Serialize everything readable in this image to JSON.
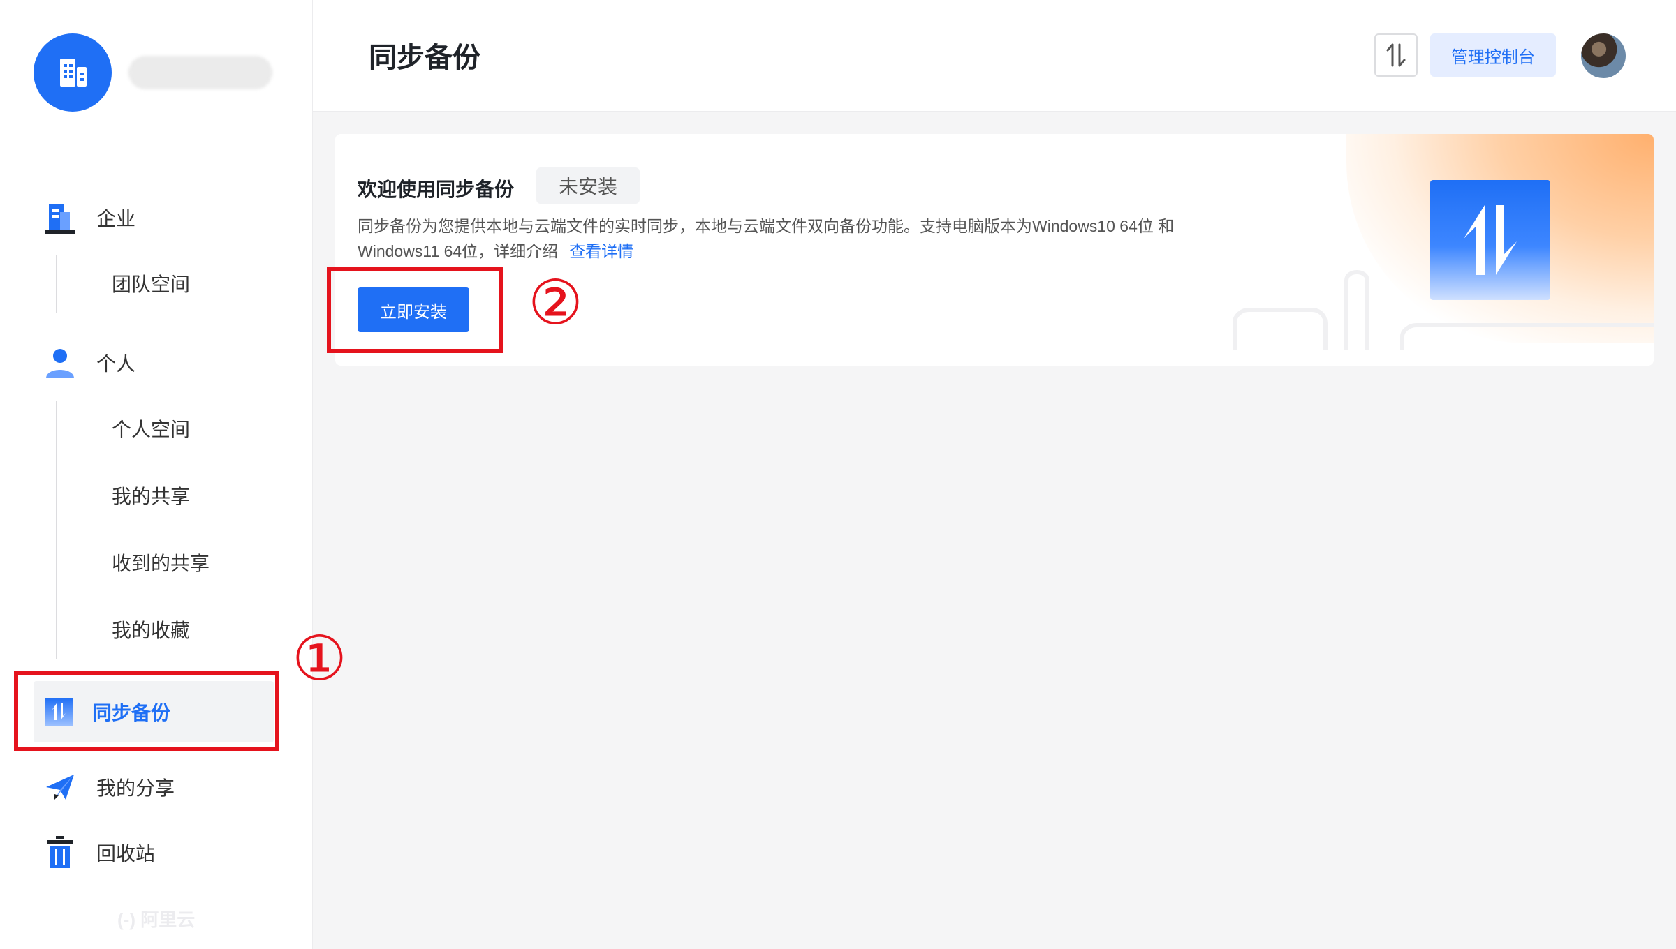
{
  "sidebar": {
    "sections": [
      {
        "label": "企业",
        "icon": "building-icon",
        "children": [
          "团队空间"
        ]
      },
      {
        "label": "个人",
        "icon": "user-icon",
        "children": [
          "个人空间",
          "我的共享",
          "收到的共享",
          "我的收藏"
        ]
      }
    ],
    "active_item": {
      "label": "同步备份",
      "icon": "sync-backup-icon"
    },
    "share_item": {
      "label": "我的分享",
      "icon": "paper-plane-icon"
    },
    "trash_item": {
      "label": "回收站",
      "icon": "trash-icon"
    },
    "footer_logo": "(-) 阿里云"
  },
  "header": {
    "title": "同步备份",
    "transfer_icon": "transfer-icon",
    "admin_button": "管理控制台"
  },
  "card": {
    "title": "欢迎使用同步备份",
    "status_tag": "未安装",
    "description": "同步备份为您提供本地与云端文件的实时同步，本地与云端文件双向备份功能。支持电脑版本为Windows10 64位 和 Windows11 64位，详细介绍",
    "details_link": "查看详情",
    "install_button": "立即安装"
  },
  "annotations": {
    "marker_1": "①",
    "marker_2": "②"
  },
  "colors": {
    "brand": "#1f6ff5",
    "highlight_red": "#e5131d"
  }
}
